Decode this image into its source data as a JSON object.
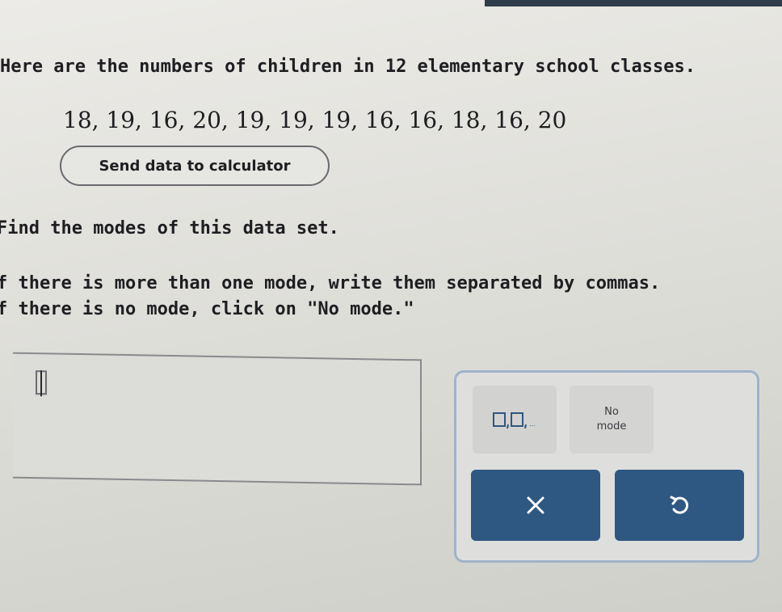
{
  "question": {
    "intro": "Here are the numbers of children in 12 elementary school classes.",
    "data_values": "18, 19, 16, 20, 19, 19, 19, 16, 16, 18, 16, 20",
    "send_button_label": "Send data to calculator",
    "prompt": "ind the modes of this data set.",
    "instruction_1": "f there is more than one mode, write them separated by commas.",
    "instruction_2": "f there is no mode, click on \"No mode.\""
  },
  "answer": {
    "value": ""
  },
  "keypad": {
    "no_mode_line1": "No",
    "no_mode_line2": "mode",
    "comma_icon": "comma-separated-boxes-icon",
    "clear_icon": "x-icon",
    "undo_icon": "undo-arrow-icon",
    "button_color": "#2e5782",
    "border_color": "#9fb3c8"
  }
}
